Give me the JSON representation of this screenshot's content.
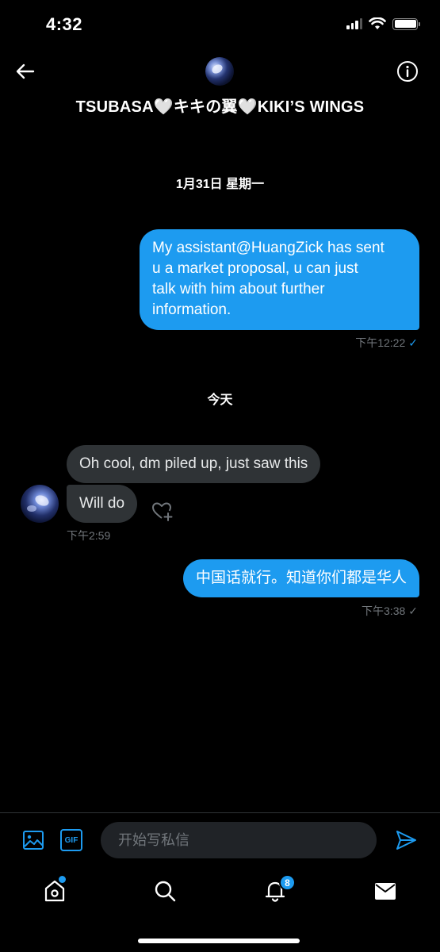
{
  "status_bar": {
    "time": "4:32"
  },
  "header": {
    "title": "TSUBASA🤍キキの翼🤍KIKI’S WINGS"
  },
  "conversation": {
    "date_1": "1月31日 星期一",
    "msg_1": {
      "lines": [
        "My assistant@HuangZick has sent",
        "u a market proposal, u can just",
        "talk with him about further",
        "information."
      ],
      "time": "下午12:22"
    },
    "date_2": "今天",
    "msg_2": {
      "text": "Oh cool, dm piled up, just saw this"
    },
    "msg_3": {
      "text": "Will do",
      "time": "下午2:59"
    },
    "msg_4": {
      "text": "中国话就行。知道你们都是华人",
      "time": "下午3:38"
    }
  },
  "composer": {
    "placeholder": "开始写私信",
    "gif_label": "GIF"
  },
  "nav": {
    "notification_count": "8"
  },
  "colors": {
    "accent": "#1d9bf0",
    "received_bubble": "#2f3336",
    "background": "#000000"
  }
}
